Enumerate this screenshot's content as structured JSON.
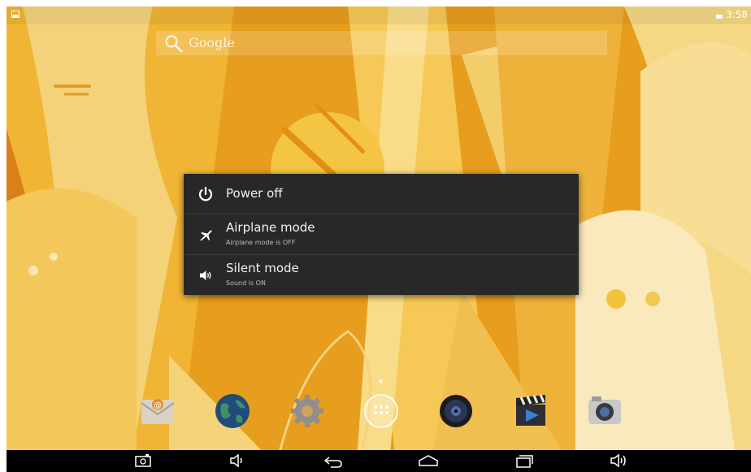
{
  "status_bar": {
    "time": "3:58"
  },
  "search": {
    "label": "Google"
  },
  "power_menu": {
    "items": [
      {
        "title": "Power off",
        "subtitle": ""
      },
      {
        "title": "Airplane mode",
        "subtitle": "Airplane mode is OFF"
      },
      {
        "title": "Silent mode",
        "subtitle": "Sound is ON"
      }
    ]
  },
  "dock": {
    "apps": [
      "email-icon",
      "browser-globe-icon",
      "settings-gear-icon",
      "app-drawer-icon",
      "music-speaker-icon",
      "video-clapper-icon",
      "camera-icon"
    ]
  },
  "navbar": {
    "buttons": [
      "screenshot-icon",
      "volume-down-icon",
      "back-icon",
      "home-icon",
      "recent-apps-icon",
      "volume-up-icon"
    ]
  }
}
